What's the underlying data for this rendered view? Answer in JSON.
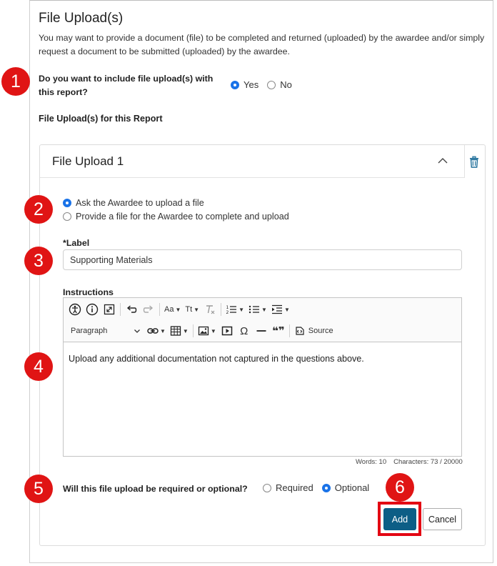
{
  "section": {
    "title": "File Upload(s)",
    "description": "You may want to provide a document (file) to be completed and returned (uploaded) by the awardee and/or simply request a document to be submitted (uploaded) by the awardee."
  },
  "include_question": {
    "label": "Do you want to include file upload(s) with this report?",
    "options": [
      {
        "label": "Yes",
        "checked": true
      },
      {
        "label": "No",
        "checked": false
      }
    ]
  },
  "uploads_heading": "File Upload(s) for this Report",
  "upload_card": {
    "title": "File Upload 1",
    "mode_options": [
      {
        "label": "Ask the Awardee to upload a file",
        "checked": true
      },
      {
        "label": "Provide a file for the Awardee to complete and upload",
        "checked": false
      }
    ],
    "label_field": {
      "label": "*Label",
      "value": "Supporting Materials"
    },
    "instructions": {
      "label": "Instructions",
      "toolbar": {
        "font_size_label": "Aa",
        "text_style_label": "Tt",
        "paragraph_select": "Paragraph",
        "source_label": "Source",
        "special_char": "Ω",
        "quote": "❝❞"
      },
      "content": "Upload any additional documentation not captured in the questions above.",
      "words": "Words: 10",
      "characters": "Characters: 73 / 20000"
    },
    "required_question": {
      "label": "Will this file upload be required or optional?",
      "options": [
        {
          "label": "Required",
          "checked": false
        },
        {
          "label": "Optional",
          "checked": true
        }
      ]
    },
    "add_label": "Add",
    "cancel_label": "Cancel"
  },
  "step_markers": [
    "1",
    "2",
    "3",
    "4",
    "5",
    "6"
  ],
  "colors": {
    "marker": "#e01414",
    "primary_button": "#0d5e86",
    "radio_checked": "#1a73e8",
    "trash_icon": "#1f6f9a"
  }
}
